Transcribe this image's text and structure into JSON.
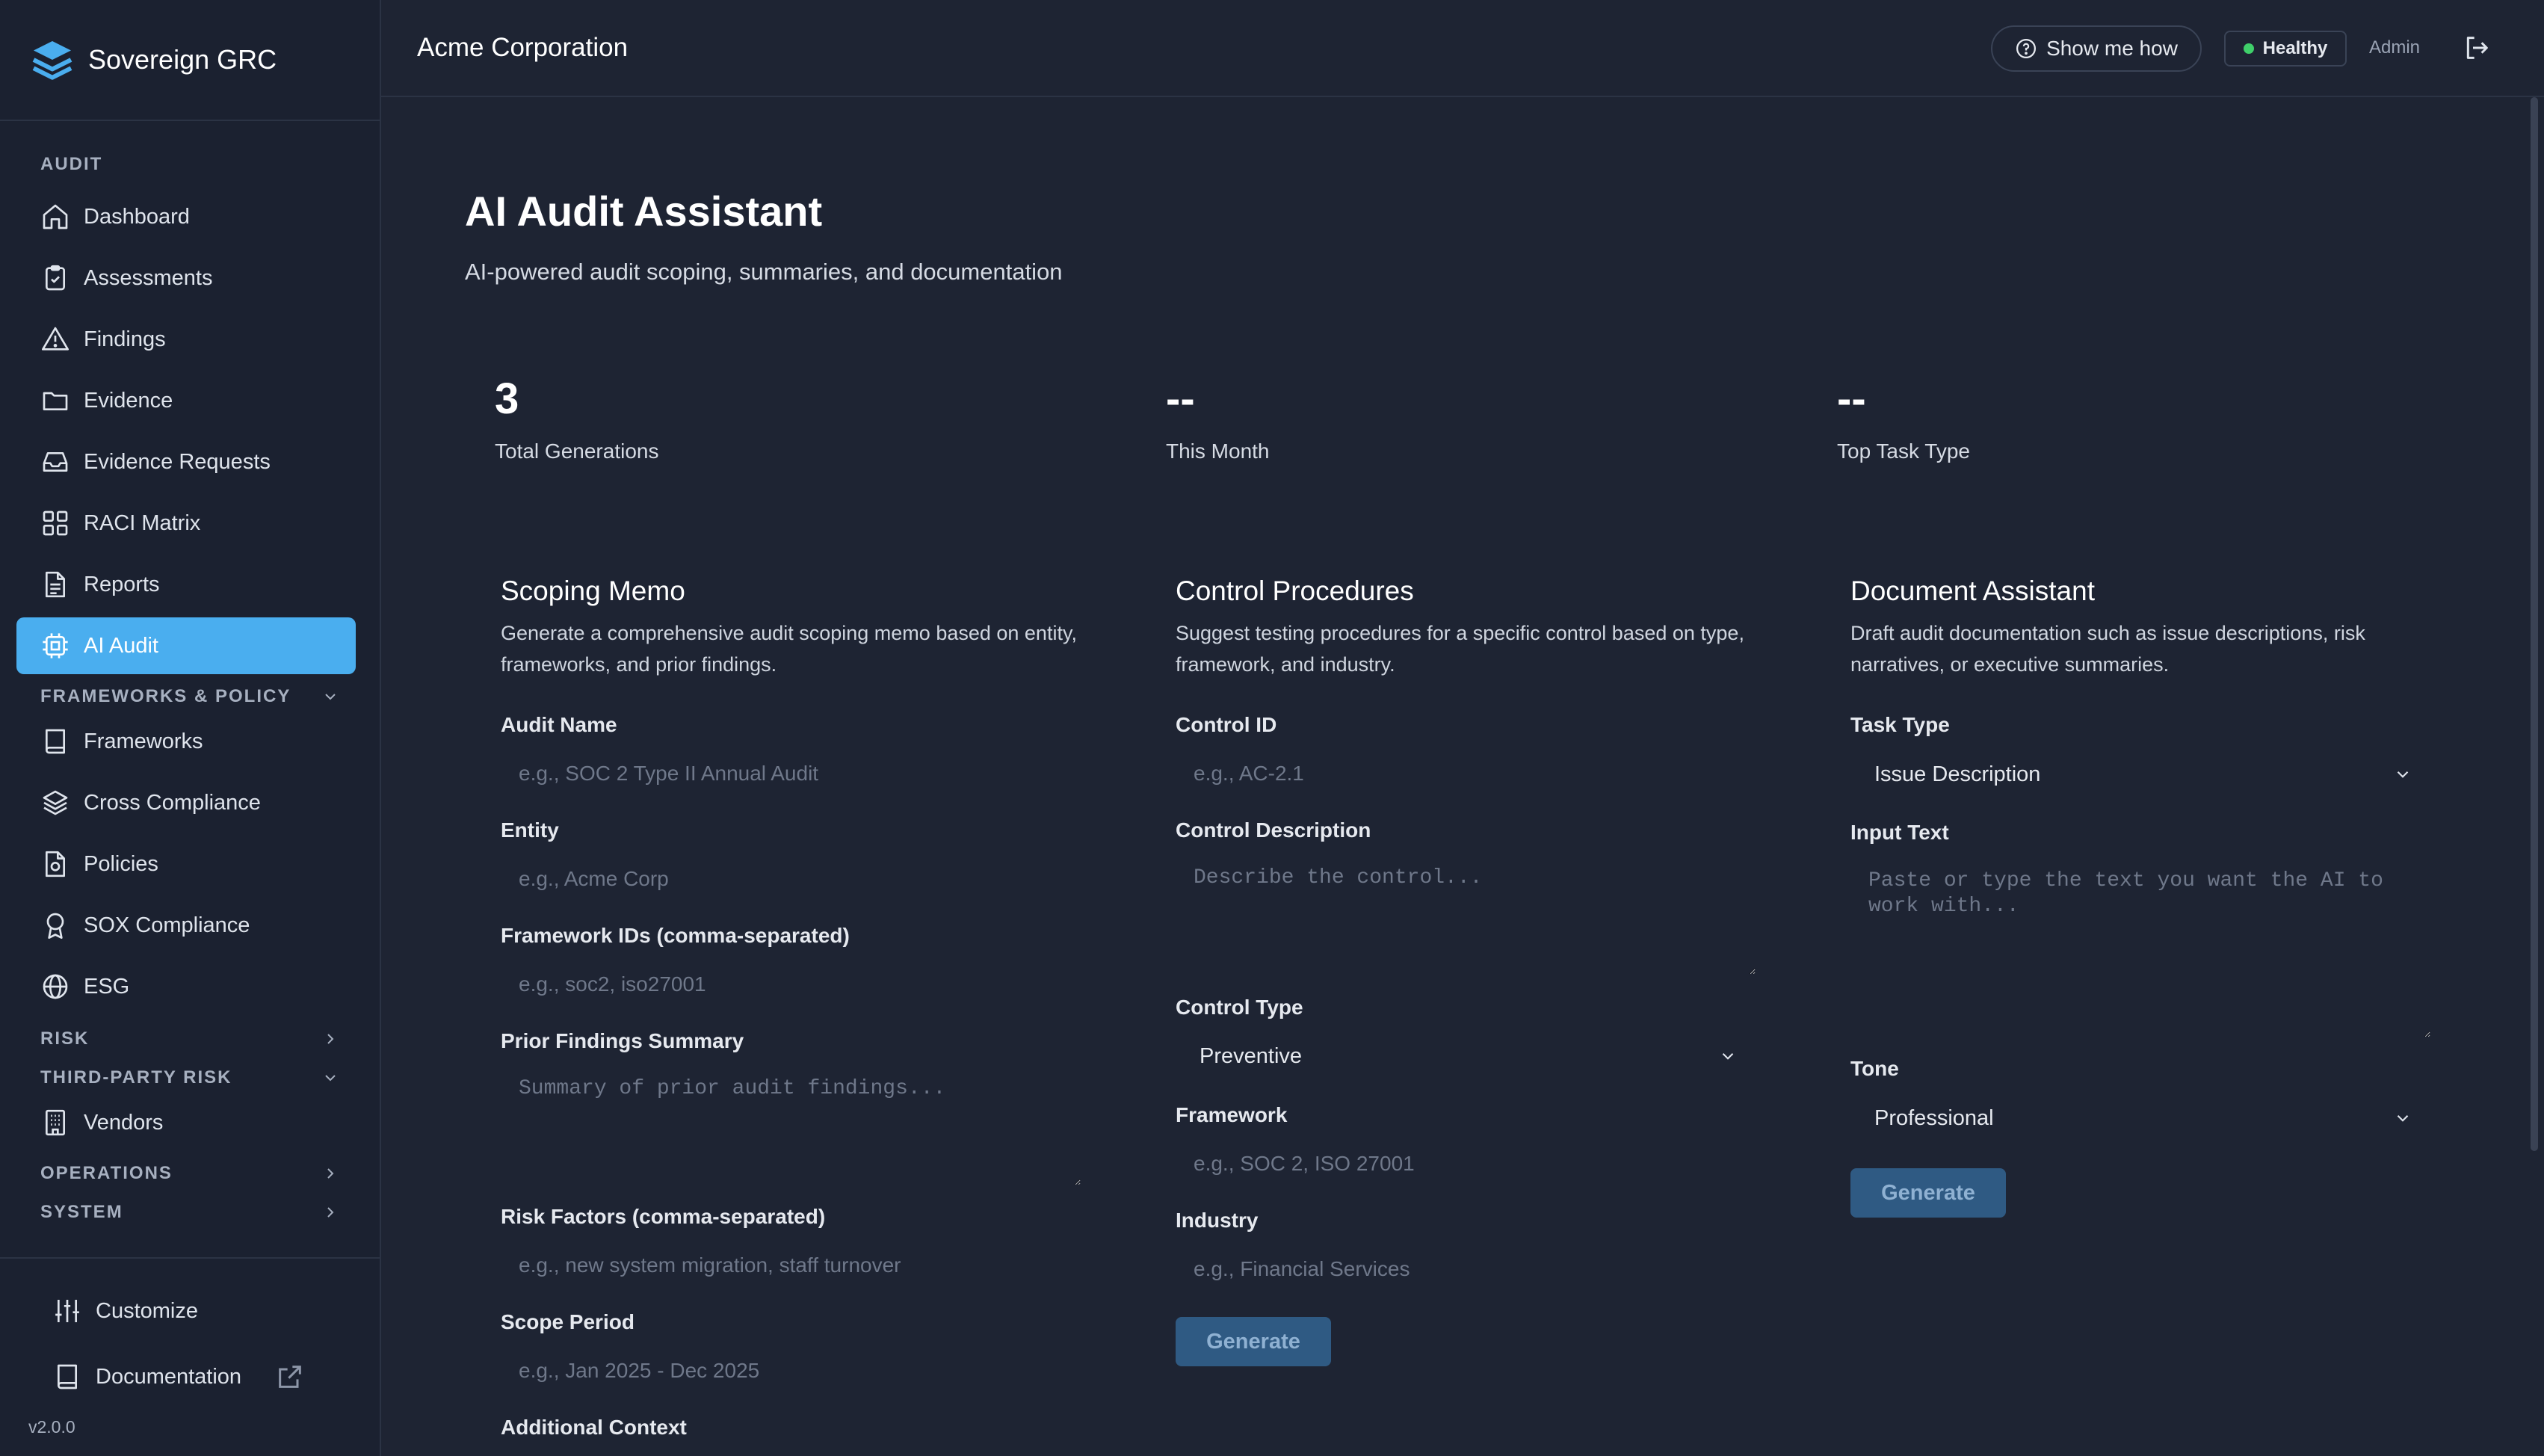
{
  "app": {
    "name": "Sovereign GRC",
    "version": "v2.0.0"
  },
  "topbar": {
    "org": "Acme Corporation",
    "help_label": "Show me how",
    "health_label": "Healthy",
    "user_label": "Admin"
  },
  "sidebar": {
    "audit_header": "AUDIT",
    "items": [
      {
        "label": "Dashboard",
        "icon": "home-icon"
      },
      {
        "label": "Assessments",
        "icon": "clipboard-check-icon"
      },
      {
        "label": "Findings",
        "icon": "warning-triangle-icon"
      },
      {
        "label": "Evidence",
        "icon": "folder-icon"
      },
      {
        "label": "Evidence Requests",
        "icon": "inbox-icon"
      },
      {
        "label": "RACI Matrix",
        "icon": "grid-icon"
      },
      {
        "label": "Reports",
        "icon": "document-icon"
      },
      {
        "label": "AI Audit",
        "icon": "cpu-icon",
        "active": true
      }
    ],
    "frameworks_header": "FRAMEWORKS & POLICY",
    "framework_items": [
      {
        "label": "Frameworks",
        "icon": "book-icon"
      },
      {
        "label": "Cross Compliance",
        "icon": "layers-icon"
      },
      {
        "label": "Policies",
        "icon": "file-check-icon"
      },
      {
        "label": "SOX Compliance",
        "icon": "award-icon"
      },
      {
        "label": "ESG",
        "icon": "globe-icon"
      }
    ],
    "risk_header": "RISK",
    "third_party_header": "THIRD-PARTY RISK",
    "third_party_items": [
      {
        "label": "Vendors",
        "icon": "building-icon"
      }
    ],
    "operations_header": "OPERATIONS",
    "system_header": "SYSTEM",
    "footer": {
      "customize": "Customize",
      "documentation": "Documentation"
    }
  },
  "page": {
    "title": "AI Audit Assistant",
    "subtitle": "AI-powered audit scoping, summaries, and documentation"
  },
  "stats": [
    {
      "value": "3",
      "label": "Total Generations"
    },
    {
      "value": "--",
      "label": "This Month"
    },
    {
      "value": "--",
      "label": "Top Task Type"
    }
  ],
  "scoping": {
    "title": "Scoping Memo",
    "description": "Generate a comprehensive audit scoping memo based on entity, frameworks, and prior findings.",
    "audit_name_label": "Audit Name",
    "audit_name_placeholder": "e.g., SOC 2 Type II Annual Audit",
    "entity_label": "Entity",
    "entity_placeholder": "e.g., Acme Corp",
    "framework_ids_label": "Framework IDs (comma-separated)",
    "framework_ids_placeholder": "e.g., soc2, iso27001",
    "prior_findings_label": "Prior Findings Summary",
    "prior_findings_placeholder": "Summary of prior audit findings...",
    "risk_factors_label": "Risk Factors (comma-separated)",
    "risk_factors_placeholder": "e.g., new system migration, staff turnover",
    "scope_period_label": "Scope Period",
    "scope_period_placeholder": "e.g., Jan 2025 - Dec 2025",
    "additional_context_label": "Additional Context"
  },
  "control": {
    "title": "Control Procedures",
    "description": "Suggest testing procedures for a specific control based on type, framework, and industry.",
    "control_id_label": "Control ID",
    "control_id_placeholder": "e.g., AC-2.1",
    "control_desc_label": "Control Description",
    "control_desc_placeholder": "Describe the control...",
    "control_type_label": "Control Type",
    "control_type_value": "Preventive",
    "framework_label": "Framework",
    "framework_placeholder": "e.g., SOC 2, ISO 27001",
    "industry_label": "Industry",
    "industry_placeholder": "e.g., Financial Services",
    "generate_label": "Generate"
  },
  "document": {
    "title": "Document Assistant",
    "description": "Draft audit documentation such as issue descriptions, risk narratives, or executive summaries.",
    "task_type_label": "Task Type",
    "task_type_value": "Issue Description",
    "input_text_label": "Input Text",
    "input_text_placeholder": "Paste or type the text you want the AI to work with...",
    "tone_label": "Tone",
    "tone_value": "Professional",
    "generate_label": "Generate"
  },
  "colors": {
    "background": "#1e2433",
    "sidebar": "#1b2130",
    "accent": "#4aaeef",
    "button_disabled": "#2f5a83",
    "healthy": "#3fcf6a"
  }
}
